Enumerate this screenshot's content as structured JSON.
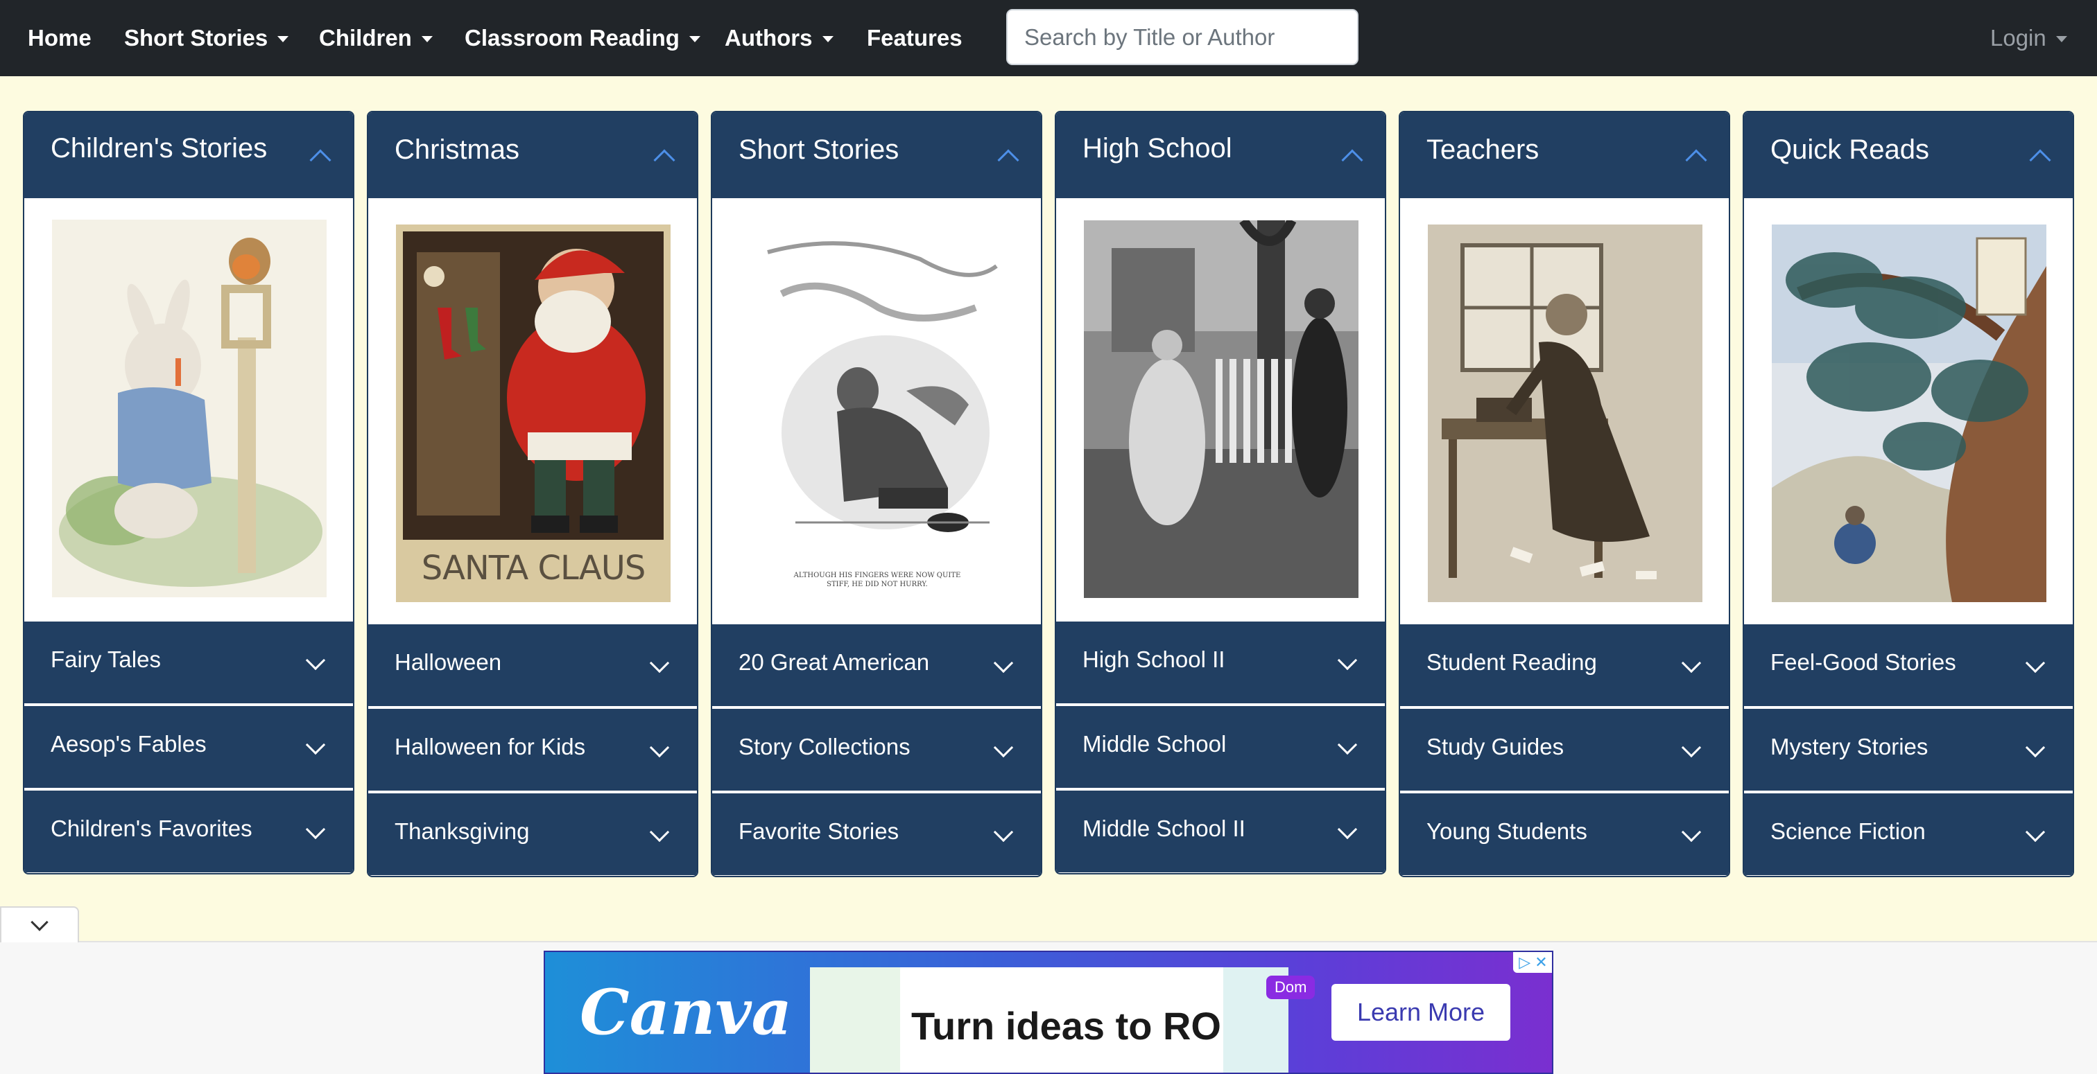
{
  "nav": {
    "items": [
      {
        "label": "Home",
        "dropdown": false
      },
      {
        "label": "Short Stories",
        "dropdown": true
      },
      {
        "label": "Children",
        "dropdown": true
      },
      {
        "label": "Classroom Reading",
        "dropdown": true
      },
      {
        "label": "Authors",
        "dropdown": true
      },
      {
        "label": "Features",
        "dropdown": false
      }
    ],
    "search_placeholder": "Search by Title or Author",
    "login_label": "Login"
  },
  "cards": [
    {
      "title": "Children's Stories",
      "subs": [
        "Fairy Tales",
        "Aesop's Fables",
        "Children's Favorites"
      ]
    },
    {
      "title": "Christmas",
      "image_caption": "SANTA CLAUS",
      "subs": [
        "Halloween",
        "Halloween for Kids",
        "Thanksgiving"
      ]
    },
    {
      "title": "Short Stories",
      "image_caption": "ALTHOUGH HIS FINGERS WERE NOW QUITE STIFF, HE DID NOT HURRY.",
      "subs": [
        "20 Great American",
        "Story Collections",
        "Favorite Stories"
      ]
    },
    {
      "title": "High School",
      "subs": [
        "High School II",
        "Middle School",
        "Middle School II"
      ]
    },
    {
      "title": "Teachers",
      "subs": [
        "Student Reading",
        "Study Guides",
        "Young Students"
      ]
    },
    {
      "title": "Quick Reads",
      "subs": [
        "Feel-Good Stories",
        "Mystery Stories",
        "Science Fiction"
      ]
    }
  ],
  "ad": {
    "brand": "Canva",
    "headline": "Turn ideas to ROI",
    "badge": "Dom",
    "cta": "Learn More",
    "close_glyphs": "▷ ✕"
  },
  "colors": {
    "navbar": "#212529",
    "page_background": "#fdfbe0",
    "card_header": "#213f62",
    "accent_chevron": "#4d8fe8"
  }
}
